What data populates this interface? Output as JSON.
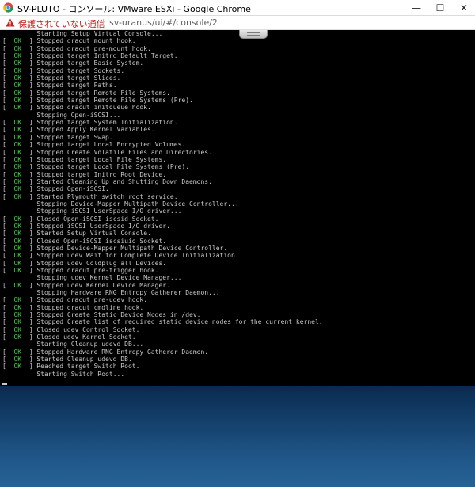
{
  "window": {
    "title": "SV-PLUTO - コンソール: VMware ESXi - Google Chrome",
    "minimize_glyph": "—",
    "maximize_glyph": "☐",
    "close_glyph": "✕"
  },
  "address_bar": {
    "security_label": "保護されていない通信",
    "url": "sv-uranus/ui/#/console/2"
  },
  "colors": {
    "ok_green": "#3fd13f",
    "console_text": "#c8c8c8",
    "console_bg": "#000000",
    "warning_red": "#c5221f"
  },
  "icons": {
    "app": "chrome-icon",
    "security": "warning-triangle-icon"
  },
  "console": {
    "lines": [
      {
        "status": "",
        "text": "Starting Setup Virtual Console..."
      },
      {
        "status": "OK",
        "text": "Stopped dracut mount hook."
      },
      {
        "status": "OK",
        "text": "Stopped dracut pre-mount hook."
      },
      {
        "status": "OK",
        "text": "Stopped target Initrd Default Target."
      },
      {
        "status": "OK",
        "text": "Stopped target Basic System."
      },
      {
        "status": "OK",
        "text": "Stopped target Sockets."
      },
      {
        "status": "OK",
        "text": "Stopped target Slices."
      },
      {
        "status": "OK",
        "text": "Stopped target Paths."
      },
      {
        "status": "OK",
        "text": "Stopped target Remote File Systems."
      },
      {
        "status": "OK",
        "text": "Stopped target Remote File Systems (Pre)."
      },
      {
        "status": "OK",
        "text": "Stopped dracut initqueue hook."
      },
      {
        "status": "",
        "text": "Stopping Open-iSCSI..."
      },
      {
        "status": "OK",
        "text": "Stopped target System Initialization."
      },
      {
        "status": "OK",
        "text": "Stopped Apply Kernel Variables."
      },
      {
        "status": "OK",
        "text": "Stopped target Swap."
      },
      {
        "status": "OK",
        "text": "Stopped target Local Encrypted Volumes."
      },
      {
        "status": "OK",
        "text": "Stopped Create Volatile Files and Directories."
      },
      {
        "status": "OK",
        "text": "Stopped target Local File Systems."
      },
      {
        "status": "OK",
        "text": "Stopped target Local File Systems (Pre)."
      },
      {
        "status": "OK",
        "text": "Stopped target Initrd Root Device."
      },
      {
        "status": "OK",
        "text": "Started Cleaning Up and Shutting Down Daemons."
      },
      {
        "status": "OK",
        "text": "Stopped Open-iSCSI."
      },
      {
        "status": "OK",
        "text": "Started Plymouth switch root service."
      },
      {
        "status": "",
        "text": "Stopping Device-Mapper Multipath Device Controller..."
      },
      {
        "status": "",
        "text": "Stopping iSCSI UserSpace I/O driver..."
      },
      {
        "status": "OK",
        "text": "Closed Open-iSCSI iscsid Socket."
      },
      {
        "status": "OK",
        "text": "Stopped iSCSI UserSpace I/O driver."
      },
      {
        "status": "OK",
        "text": "Started Setup Virtual Console."
      },
      {
        "status": "OK",
        "text": "Closed Open-iSCSI iscsiuio Socket."
      },
      {
        "status": "OK",
        "text": "Stopped Device-Mapper Multipath Device Controller."
      },
      {
        "status": "OK",
        "text": "Stopped udev Wait for Complete Device Initialization."
      },
      {
        "status": "OK",
        "text": "Stopped udev Coldplug all Devices."
      },
      {
        "status": "OK",
        "text": "Stopped dracut pre-trigger hook."
      },
      {
        "status": "",
        "text": "Stopping udev Kernel Device Manager..."
      },
      {
        "status": "OK",
        "text": "Stopped udev Kernel Device Manager."
      },
      {
        "status": "",
        "text": "Stopping Hardware RNG Entropy Gatherer Daemon..."
      },
      {
        "status": "OK",
        "text": "Stopped dracut pre-udev hook."
      },
      {
        "status": "OK",
        "text": "Stopped dracut cmdline hook."
      },
      {
        "status": "OK",
        "text": "Stopped Create Static Device Nodes in /dev."
      },
      {
        "status": "OK",
        "text": "Stopped Create list of required static device nodes for the current kernel."
      },
      {
        "status": "OK",
        "text": "Closed udev Control Socket."
      },
      {
        "status": "OK",
        "text": "Closed udev Kernel Socket."
      },
      {
        "status": "",
        "text": "Starting Cleanup udevd DB..."
      },
      {
        "status": "OK",
        "text": "Stopped Hardware RNG Entropy Gatherer Daemon."
      },
      {
        "status": "OK",
        "text": "Started Cleanup udevd DB."
      },
      {
        "status": "OK",
        "text": "Reached target Switch Root."
      },
      {
        "status": "",
        "text": "Starting Switch Root..."
      }
    ]
  }
}
